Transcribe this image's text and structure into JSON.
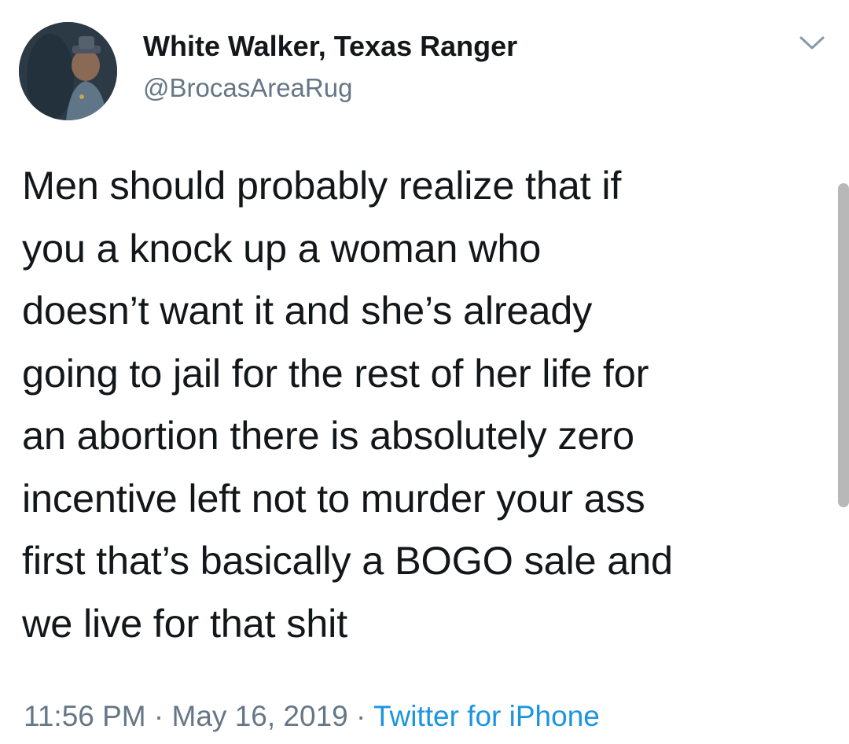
{
  "tweet": {
    "author": {
      "display_name": "White Walker, Texas Ranger",
      "handle": "@BrocasAreaRug",
      "avatar_icon": "profile-photo"
    },
    "menu_icon": "chevron-down-icon",
    "text": "Men should probably realize that if\nyou a knock up a woman who\ndoesn’t want it and she’s already\ngoing to jail for the rest of her life for\nan abortion there is absolutely zero\nincentive left not to murder your ass\nfirst that’s basically a BOGO sale and\nwe live for that shit",
    "time": "11:56 PM",
    "separator_1": " · ",
    "date": "May 16, 2019",
    "separator_2": " · ",
    "source": "Twitter for iPhone"
  },
  "colors": {
    "text": "#14171a",
    "secondary": "#657786",
    "link": "#1b95e0",
    "background": "#ffffff"
  }
}
